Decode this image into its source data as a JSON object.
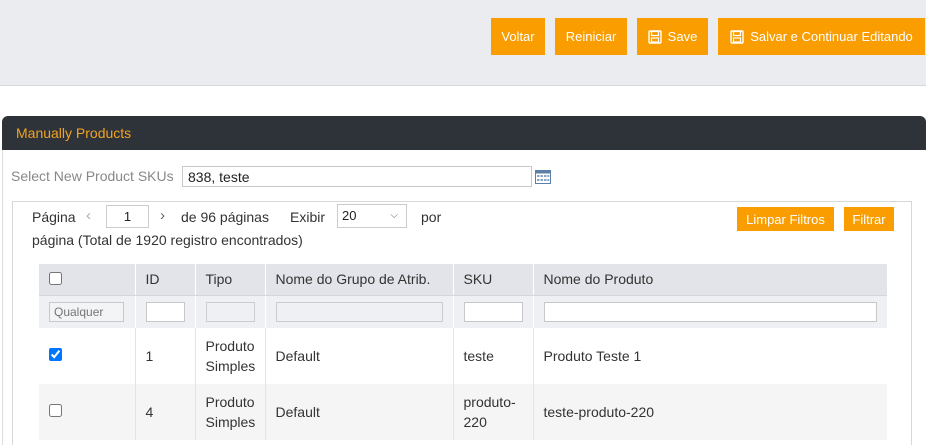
{
  "toolbar": {
    "voltar": "Voltar",
    "reiniciar": "Reiniciar",
    "save": "Save",
    "salvar_continuar": "Salvar e Continuar Editando"
  },
  "panel": {
    "title": "Manually Products"
  },
  "sku": {
    "label": "Select New Product SKUs",
    "value": "838, teste"
  },
  "pager": {
    "pagina_label": "Página",
    "current_page": "1",
    "total_text": "de 96 páginas",
    "exibir_label": "Exibir",
    "per_page": "20",
    "por_label": "por",
    "line2": "página (Total de 1920 registro encontrados)"
  },
  "filters": {
    "limpar": "Limpar Filtros",
    "filtrar": "Filtrar",
    "any_placeholder": "Qualquer"
  },
  "table": {
    "headers": [
      "",
      "ID",
      "Tipo",
      "Nome do Grupo de Atrib.",
      "SKU",
      "Nome do Produto"
    ],
    "rows": [
      {
        "checked": true,
        "id": "1",
        "tipo_1": "Produto",
        "tipo_2": "Simples",
        "grupo": "Default",
        "sku_1": "teste",
        "sku_2": "",
        "nome": "Produto Teste 1"
      },
      {
        "checked": false,
        "id": "4",
        "tipo_1": "Produto",
        "tipo_2": "Simples",
        "grupo": "Default",
        "sku_1": "produto-",
        "sku_2": "220",
        "nome": "teste-produto-220"
      }
    ]
  },
  "colors": {
    "accent": "#f99d00",
    "header_bg": "#2e3339",
    "title_color": "#f3a321"
  }
}
